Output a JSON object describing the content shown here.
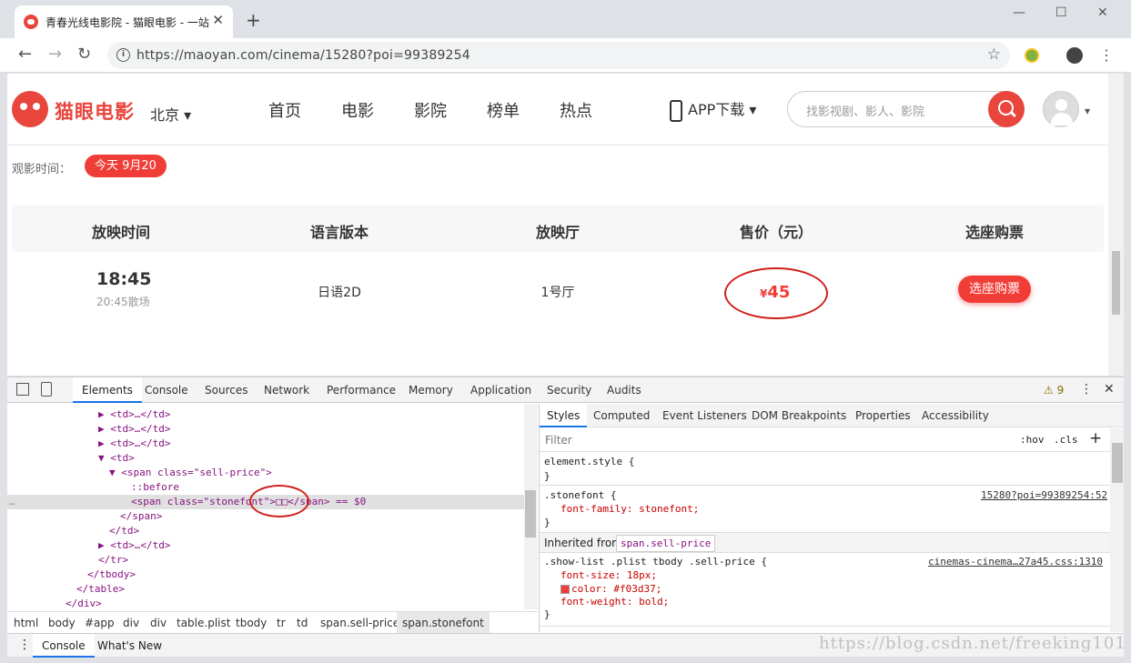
{
  "browser": {
    "tab_title": "青春光线电影院 - 猫眼电影 - 一站式购票",
    "close_tab": "✕",
    "new_tab": "+",
    "minimize": "—",
    "maximize": "☐",
    "close_window": "✕",
    "back": "←",
    "forward": "→",
    "reload": "↻",
    "url": "https://maoyan.com/cinema/15280?poi=99389254",
    "star": "☆",
    "menu": "⋮"
  },
  "site": {
    "logo": "猫眼电影",
    "city": "北京 ▾",
    "nav": [
      "首页",
      "电影",
      "影院",
      "榜单",
      "热点"
    ],
    "app_download": "APP下载 ▾",
    "search_placeholder": "找影视剧、影人、影院",
    "avatar_caret": "▾"
  },
  "showtimes": {
    "watch_time_label": "观影时间：",
    "date_chip": "今天 9月20",
    "headers": [
      "放映时间",
      "语言版本",
      "放映厅",
      "售价（元）",
      "选座购票"
    ],
    "row": {
      "start": "18:45",
      "end": "20:45散场",
      "language": "日语2D",
      "hall": "1号厅",
      "currency": "¥",
      "price": "45",
      "buy": "选座购票"
    }
  },
  "devtools": {
    "tabs": [
      "Elements",
      "Console",
      "Sources",
      "Network",
      "Performance",
      "Memory",
      "Application",
      "Security",
      "Audits"
    ],
    "warnings": "⚠ 9",
    "dom_lines": [
      "▶ <td>…</td>",
      "▶ <td>…</td>",
      "▶ <td>…</td>",
      "▼ <td>",
      "▼ <span class=\"sell-price\">",
      "::before",
      "<span class=\"stonefont\">□□</span> == $0",
      "</span>",
      "</td>",
      "▶ <td>…</td>",
      "</tr>",
      "</tbody>",
      "</table>",
      "</div>"
    ],
    "breadcrumbs": [
      "html",
      "body",
      "#app",
      "div",
      "div",
      "table.plist",
      "tbody",
      "tr",
      "td",
      "span.sell-price",
      "span.stonefont"
    ],
    "styles_tabs": [
      "Styles",
      "Computed",
      "Event Listeners",
      "DOM Breakpoints",
      "Properties",
      "Accessibility"
    ],
    "filter_placeholder": "Filter",
    "hov": ":hov",
    "cls": ".cls",
    "add": "+",
    "element_style": "element.style {",
    "close_brace": "}",
    "rule1": {
      "selector": ".stonefont {",
      "source": "15280?poi=99389254:52",
      "decl": "font-family: stonefont;"
    },
    "inherited_label": "Inherited from",
    "inherited_from": "span.sell-price",
    "rule2": {
      "selector": ".show-list .plist tbody .sell-price {",
      "source": "cinemas-cinema…27a45.css:1310",
      "decl1": "font-size: 18px;",
      "decl2": "color: #f03d37;",
      "decl3": "font-weight: bold;"
    },
    "drawer_tabs": [
      "Console",
      "What's New"
    ]
  },
  "watermark": "https://blog.csdn.net/freeking101",
  "colors": {
    "brand": "#e8453c",
    "price": "#f03d37",
    "annotation": "#d0201c"
  }
}
